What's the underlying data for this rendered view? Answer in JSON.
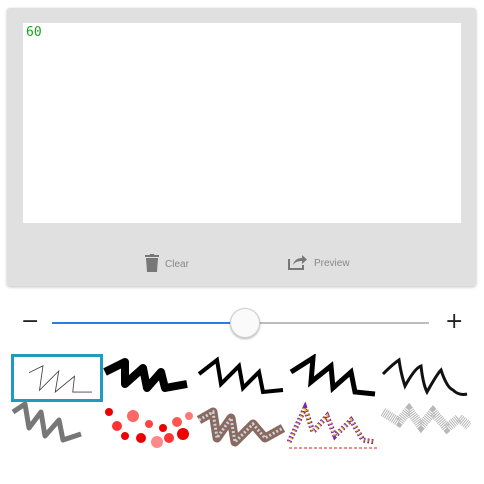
{
  "canvas": {
    "counter": "60"
  },
  "actions": {
    "clear_label": "Clear",
    "preview_label": "Preview"
  },
  "slider": {
    "minus_label": "−",
    "plus_label": "+",
    "value_fraction": 0.5
  },
  "colors": {
    "accent": "#2d7de0",
    "selected_border": "#1f9bbf",
    "counter": "#1aa31a"
  },
  "brushes": [
    {
      "name": "pencil",
      "selected": true
    },
    {
      "name": "marker"
    },
    {
      "name": "pen"
    },
    {
      "name": "calligraphy"
    },
    {
      "name": "ink"
    },
    {
      "name": "gradient"
    },
    {
      "name": "red-dots"
    },
    {
      "name": "textured-3d"
    },
    {
      "name": "confetti"
    },
    {
      "name": "spray"
    }
  ]
}
